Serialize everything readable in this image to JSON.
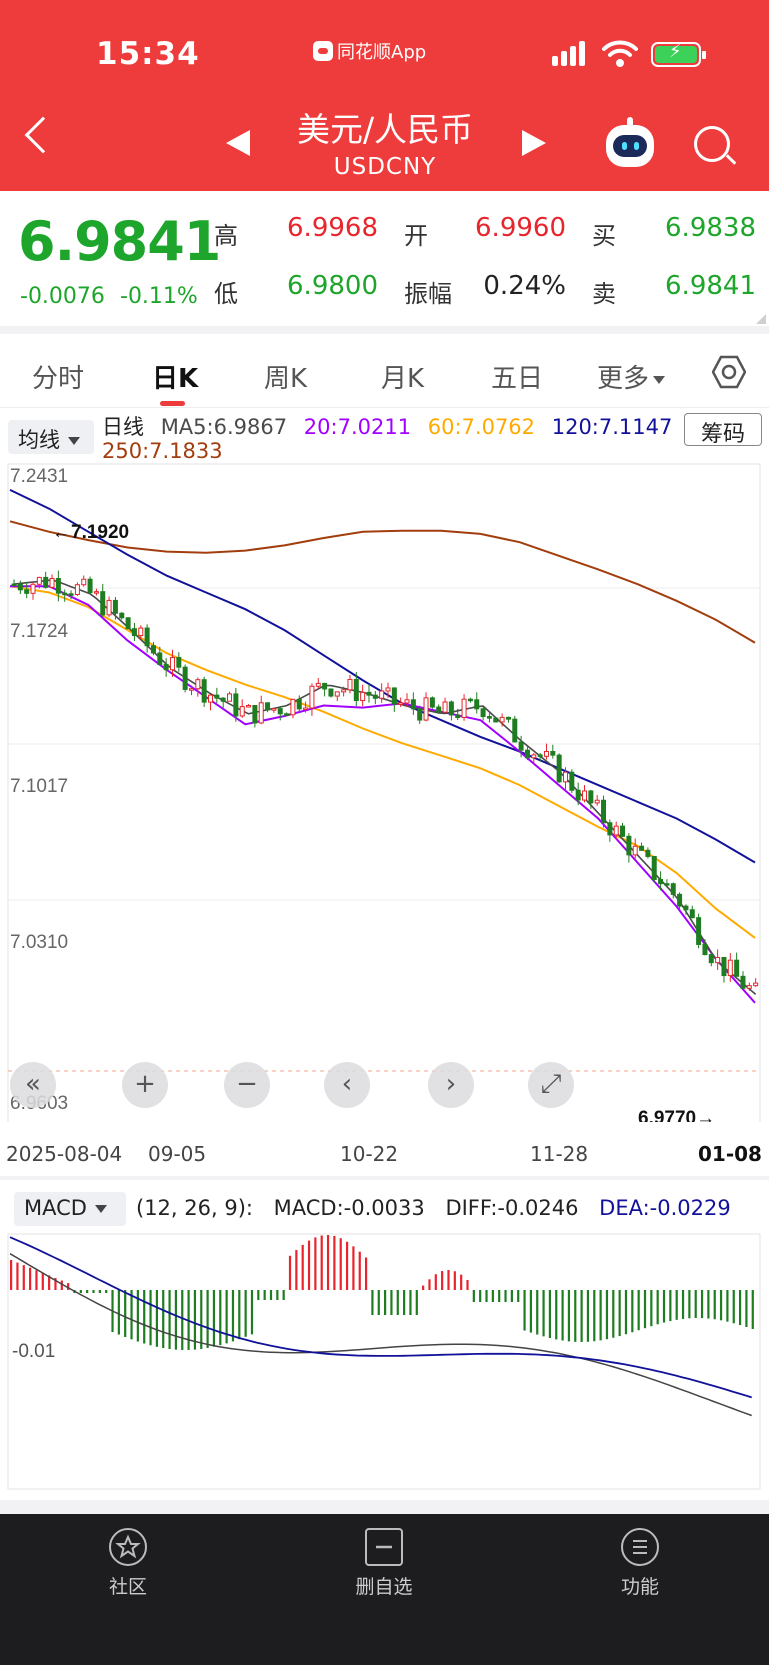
{
  "status_bar": {
    "time": "15:34",
    "app_name": "同花顺App"
  },
  "header": {
    "title": "美元/人民币",
    "code": "USDCNY"
  },
  "quote": {
    "last": "6.9841",
    "change": "-0.0076",
    "change_pct": "-0.11%",
    "high_label": "高",
    "high": "6.9968",
    "open_label": "开",
    "open": "6.9960",
    "bid_label": "买",
    "bid": "6.9838",
    "low_label": "低",
    "low": "6.9800",
    "amp_label": "振幅",
    "amp": "0.24%",
    "ask_label": "卖",
    "ask": "6.9841"
  },
  "tabs": [
    "分时",
    "日K",
    "周K",
    "月K",
    "五日",
    "更多"
  ],
  "active_tab": "日K",
  "ma_info": {
    "select_label": "均线",
    "period": "日线",
    "ma5": "MA5:6.9867",
    "ma20": "20:7.0211",
    "ma60": "60:7.0762",
    "ma120": "120:7.1147",
    "ma250": "250:7.1833",
    "chip_button": "筹码"
  },
  "colors": {
    "up": "#e8242c",
    "down": "#1e7d20",
    "ma5": "#4a4a4a",
    "ma20": "#a200ff",
    "ma60": "#ffaa00",
    "ma120": "#11119a",
    "ma250": "#a23d0d",
    "header": "#ee3b3b"
  },
  "chart_data": {
    "type": "candlestick",
    "price_axis_labels": [
      "7.2431",
      "7.1724",
      "7.1017",
      "7.0310",
      "6.9603"
    ],
    "ylim": [
      6.9603,
      7.2431
    ],
    "x_dates": [
      "2025-08-04",
      "09-05",
      "10-22",
      "11-28",
      "01-08"
    ],
    "annotations": {
      "period_high": "←7.1920",
      "period_low": "6.9770→"
    },
    "ma_labels": [
      "MA5",
      "MA20",
      "MA60",
      "MA120",
      "MA250"
    ],
    "series": [
      {
        "name": "MA250",
        "values": [
          7.21,
          7.205,
          7.201,
          7.1975,
          7.1955,
          7.195,
          7.196,
          7.1985,
          7.202,
          7.205,
          7.2055,
          7.2055,
          7.204,
          7.2,
          7.1935,
          7.187,
          7.18,
          7.172,
          7.163,
          7.152
        ]
      },
      {
        "name": "MA120",
        "values": [
          7.225,
          7.216,
          7.205,
          7.194,
          7.184,
          7.176,
          7.168,
          7.158,
          7.146,
          7.134,
          7.123,
          7.115,
          7.107,
          7.1,
          7.092,
          7.084,
          7.076,
          7.068,
          7.058,
          7.047
        ]
      },
      {
        "name": "MA60",
        "values": [
          7.179,
          7.176,
          7.169,
          7.158,
          7.147,
          7.139,
          7.132,
          7.126,
          7.119,
          7.111,
          7.104,
          7.098,
          7.092,
          7.084,
          7.074,
          7.064,
          7.055,
          7.042,
          7.025,
          7.011
        ]
      },
      {
        "name": "MA20",
        "values": [
          7.179,
          7.179,
          7.17,
          7.153,
          7.139,
          7.126,
          7.113,
          7.117,
          7.122,
          7.121,
          7.123,
          7.119,
          7.115,
          7.1,
          7.084,
          7.068,
          7.047,
          7.026,
          7.001,
          6.98
        ]
      }
    ]
  },
  "controls": [
    "«",
    "+",
    "−",
    "‹",
    "›",
    "⤢"
  ],
  "macd": {
    "select_label": "MACD",
    "params": "(12, 26, 9):",
    "macd": "MACD:-0.0033",
    "diff": "DIFF:-0.0246",
    "dea": "DEA:-0.0229",
    "axis_label": "-0.01"
  },
  "bottom_nav": [
    {
      "label": "社区",
      "icon": "community-icon"
    },
    {
      "label": "删自选",
      "icon": "remove-watchlist-icon"
    },
    {
      "label": "功能",
      "icon": "menu-icon"
    }
  ]
}
